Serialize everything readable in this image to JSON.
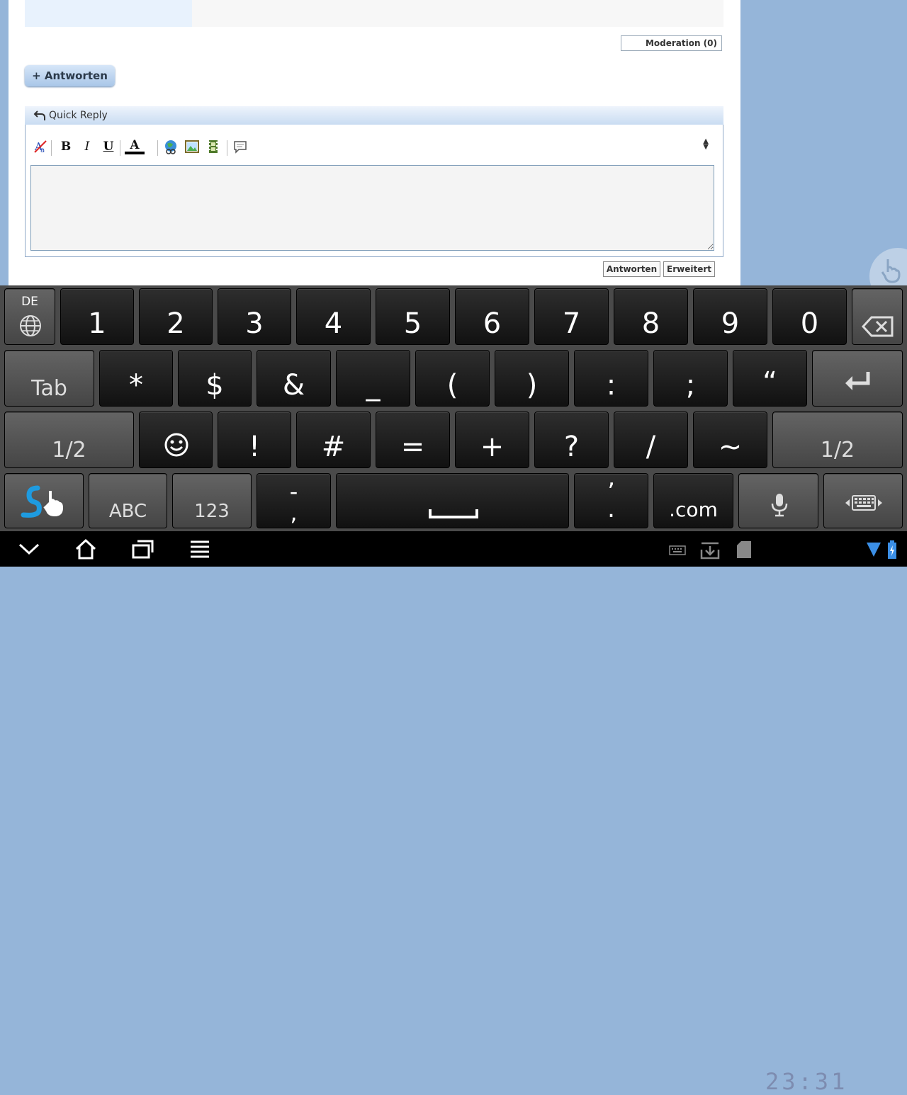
{
  "forum": {
    "moderation_label": "Moderation (0)",
    "reply_button": "+ Antworten",
    "quick_reply_title": "Quick Reply",
    "toolbar": {
      "bold": "B",
      "italic": "I",
      "underline": "U",
      "font_color": "A"
    },
    "editor_value": "",
    "submit_label": "Antworten",
    "advanced_label": "Erweitert"
  },
  "keyboard": {
    "language": "DE",
    "row1": [
      "1",
      "2",
      "3",
      "4",
      "5",
      "6",
      "7",
      "8",
      "9",
      "0"
    ],
    "row2_tab": "Tab",
    "row2": [
      "*",
      "$",
      "&",
      "_",
      "(",
      ")",
      ":",
      ";",
      "“"
    ],
    "row3_left": "1/2",
    "row3": [
      "!",
      "#",
      "=",
      "+",
      "?",
      "/",
      "~"
    ],
    "row3_right": "1/2",
    "row4_abc": "ABC",
    "row4_123": "123",
    "row4_dash_top": "-",
    "row4_dash_bottom": ",",
    "row4_quote_top": "’",
    "row4_quote_bottom": ".",
    "row4_com": ".com"
  },
  "status": {
    "time": "23:31"
  }
}
